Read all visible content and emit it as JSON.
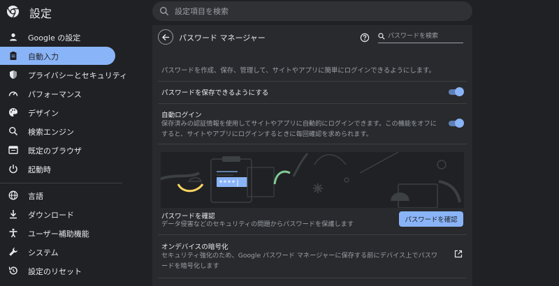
{
  "header": {
    "title": "設定",
    "search_placeholder": "設定項目を検索"
  },
  "sidebar": {
    "items": [
      {
        "label": "Google の設定",
        "icon": "person-icon"
      },
      {
        "label": "自動入力",
        "icon": "clipboard-icon",
        "active": true
      },
      {
        "label": "プライバシーとセキュリティ",
        "icon": "shield-icon"
      },
      {
        "label": "パフォーマンス",
        "icon": "speedometer-icon"
      },
      {
        "label": "デザイン",
        "icon": "palette-icon"
      },
      {
        "label": "検索エンジン",
        "icon": "search-icon"
      },
      {
        "label": "既定のブラウザ",
        "icon": "browser-icon"
      },
      {
        "label": "起動時",
        "icon": "power-icon"
      },
      {
        "label": "言語",
        "icon": "globe-icon"
      },
      {
        "label": "ダウンロード",
        "icon": "download-icon"
      },
      {
        "label": "ユーザー補助機能",
        "icon": "accessibility-icon"
      },
      {
        "label": "システム",
        "icon": "wrench-icon"
      },
      {
        "label": "設定のリセット",
        "icon": "reset-icon"
      }
    ]
  },
  "main": {
    "title": "パスワード マネージャー",
    "search_placeholder": "パスワードを検索",
    "description": "パスワードを作成、保存、管理して、サイトやアプリに簡単にログインできるようにします。",
    "offer_save": {
      "title": "パスワードを保存できるようにする",
      "enabled": true
    },
    "auto_signin": {
      "title": "自動ログイン",
      "subtitle": "保存済みの認証情報を使用してサイトやアプリに自動的にログインできます。この機能をオフにすると、サイトやアプリにログインするときに毎回確認を求められます。",
      "enabled": true
    },
    "illustration": {
      "password_mask": "****|"
    },
    "checkup": {
      "title": "パスワードを確認",
      "subtitle": "データ侵害などのセキュリティの問題からパスワードを保護します",
      "button": "パスワードを確認"
    },
    "encryption": {
      "title": "オンデバイスの暗号化",
      "subtitle": "セキュリティ強化のため、Google パスワード マネージャーに保存する前にデバイス上でパスワードを暗号化します"
    }
  },
  "colors": {
    "background": "#202124",
    "card": "#292a2d",
    "accent": "#8ab4f8",
    "text": "#e8eaed",
    "secondary_text": "#9aa0a6"
  }
}
